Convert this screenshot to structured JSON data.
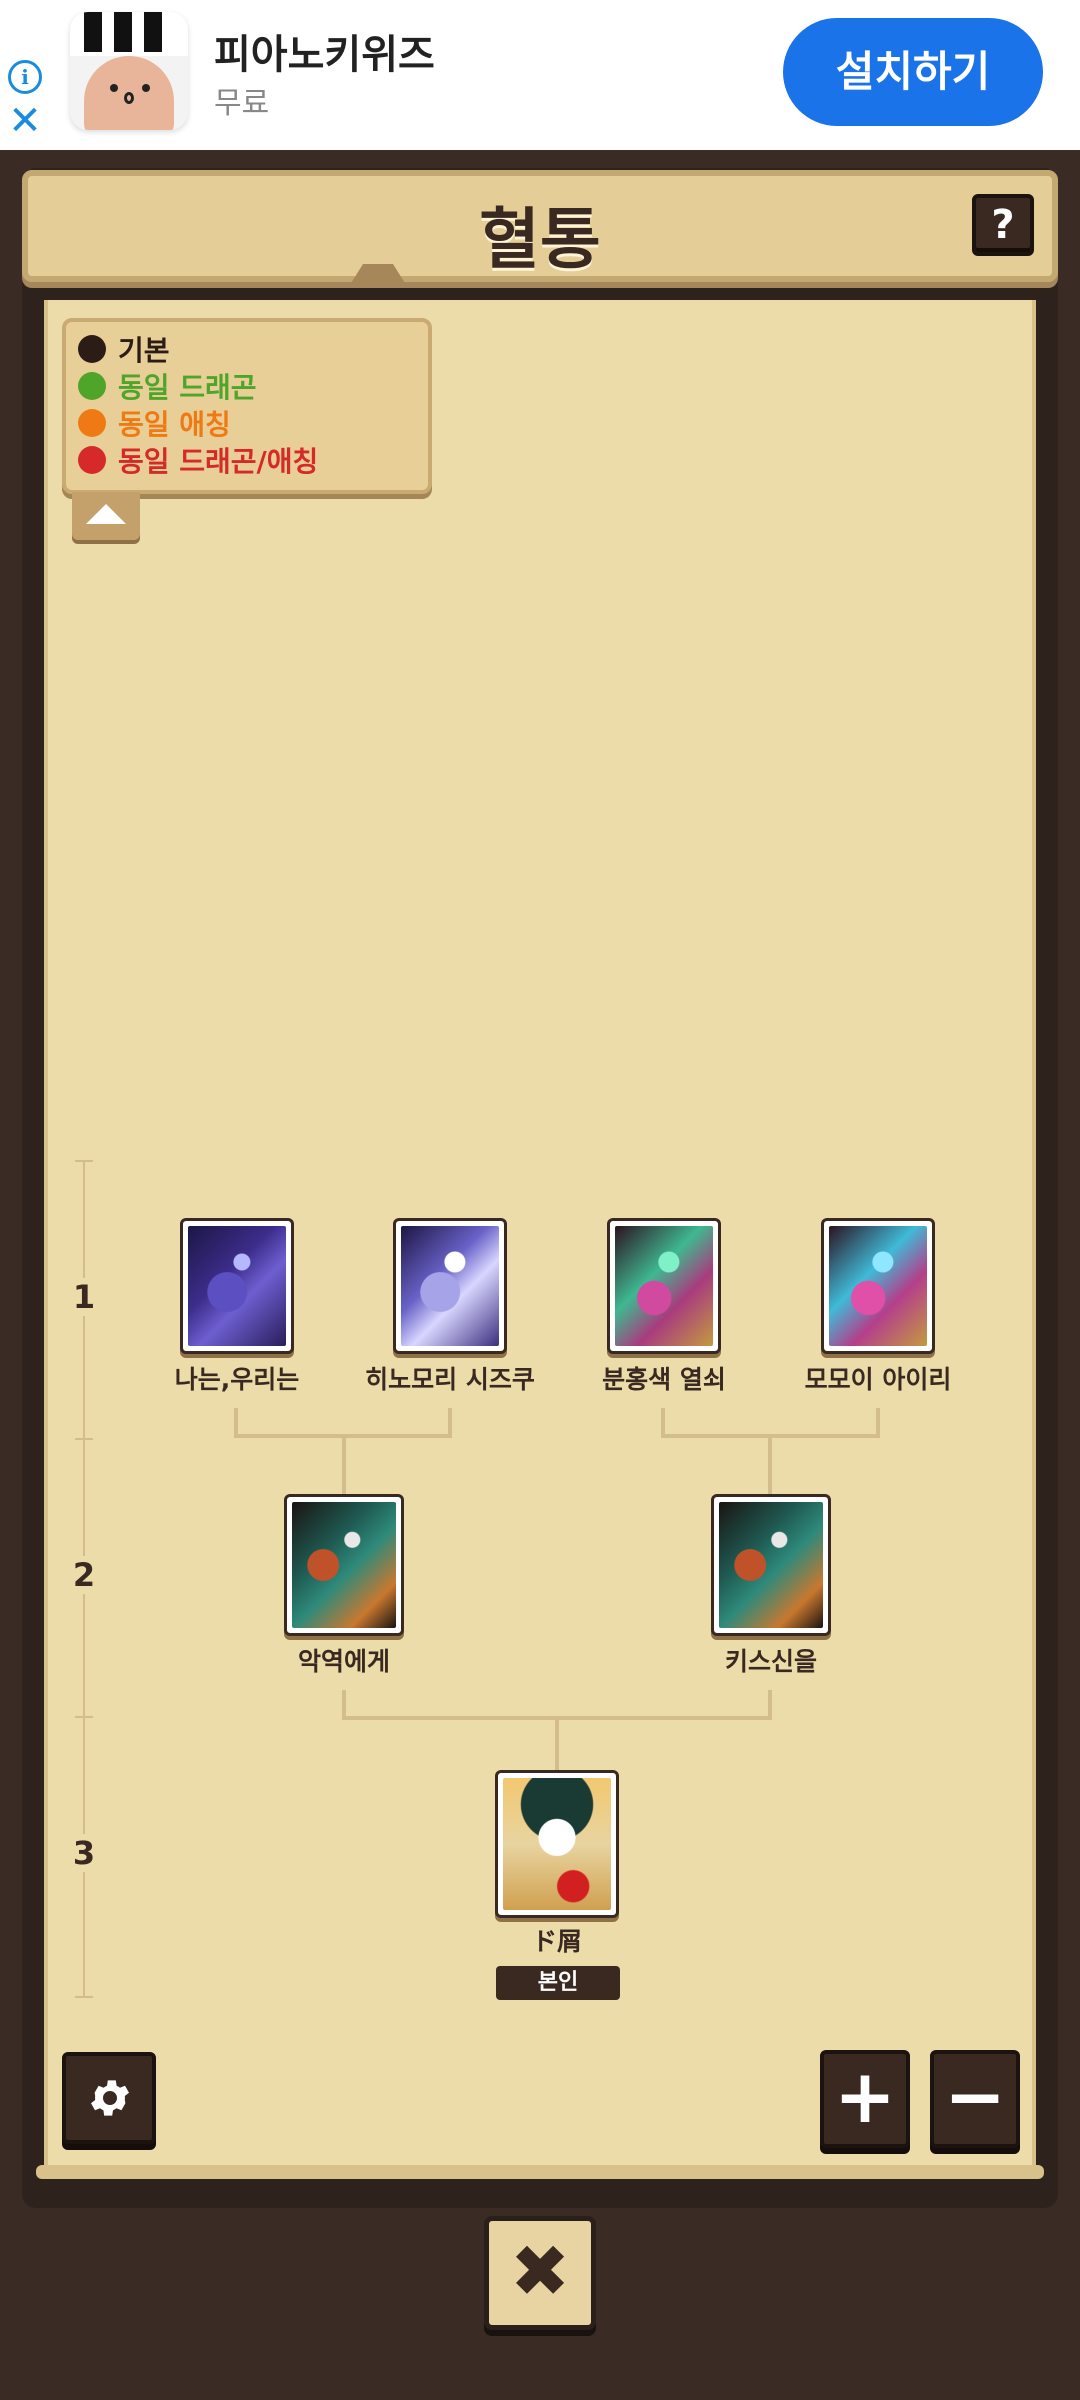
{
  "ad": {
    "app_name": "피아노키위즈",
    "price": "무료",
    "install_label": "설치하기",
    "info_glyph": "i",
    "close_glyph": "✕"
  },
  "header": {
    "title": "혈통",
    "help_label": "?"
  },
  "legend": {
    "items": [
      {
        "label": "기본",
        "color": "#2b1d16"
      },
      {
        "label": "동일 드래곤",
        "color": "#4fa52a"
      },
      {
        "label": "동일 애칭",
        "color": "#ef7a14"
      },
      {
        "label": "동일 드래곤/애칭",
        "color": "#d62a2a"
      }
    ]
  },
  "generations": [
    "1",
    "2",
    "3"
  ],
  "tree": {
    "gen1": [
      {
        "name": "나는,우리는",
        "art": "p-blue"
      },
      {
        "name": "히노모리 시즈쿠",
        "art": "p-white"
      },
      {
        "name": "분홍색 열쇠",
        "art": "p-green"
      },
      {
        "name": "모모이 아이리",
        "art": "p-cyan"
      }
    ],
    "gen2": [
      {
        "name": "악역에게",
        "art": "p-dark"
      },
      {
        "name": "키스신을",
        "art": "p-dark"
      }
    ],
    "gen3": {
      "name": "ド屑",
      "art": "p-girl",
      "badge": "본인"
    }
  },
  "controls": {
    "settings_icon": "gear-icon",
    "zoom_in": "+",
    "zoom_out": "−",
    "close": "✖"
  }
}
